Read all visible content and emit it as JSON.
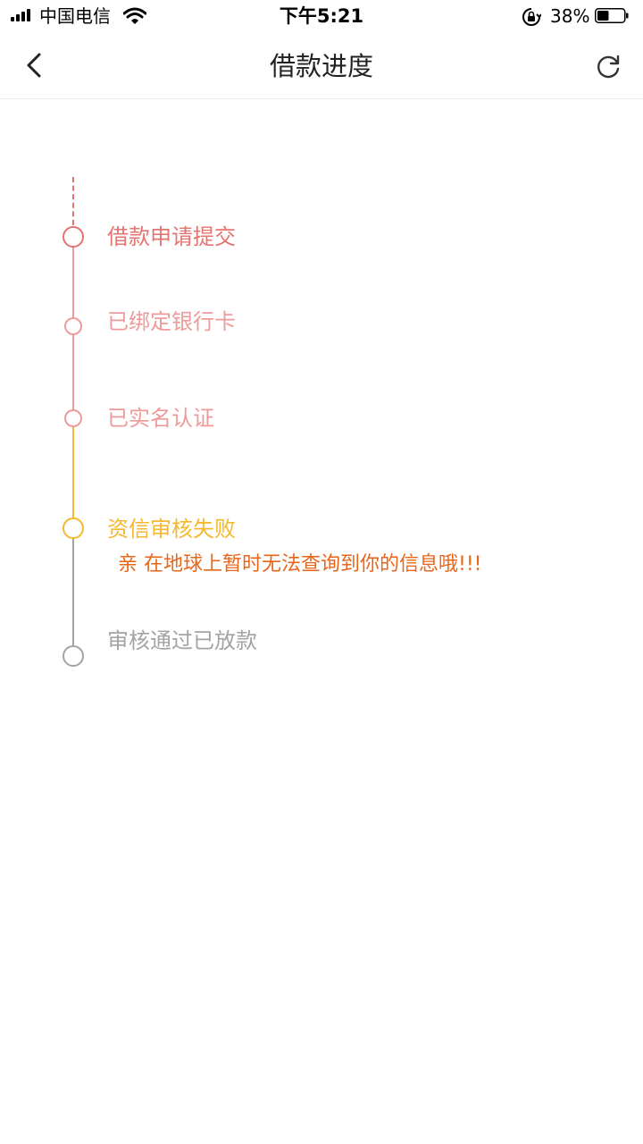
{
  "status_bar": {
    "carrier": "中国电信",
    "time": "下午5:21",
    "battery": "38%",
    "icons": [
      "signal-icon",
      "wifi-icon",
      "orientation-lock-icon",
      "battery-icon"
    ]
  },
  "nav": {
    "title": "借款进度",
    "back_icon": "chevron-left-icon",
    "refresh_icon": "refresh-icon"
  },
  "timeline": {
    "colors": {
      "done_primary": "#e5736f",
      "done_light": "#ef9a9a",
      "failed": "#f5b82e",
      "message": "#e8661a",
      "pending": "#a3a3a3"
    },
    "steps": [
      {
        "label": "借款申请提交",
        "status": "done"
      },
      {
        "label": "已绑定银行卡",
        "status": "done"
      },
      {
        "label": "已实名认证",
        "status": "done"
      },
      {
        "label": "资信审核失败",
        "status": "failed",
        "message": "亲 在地球上暂时无法查询到你的信息哦!!!"
      },
      {
        "label": "审核通过已放款",
        "status": "pending"
      }
    ]
  }
}
